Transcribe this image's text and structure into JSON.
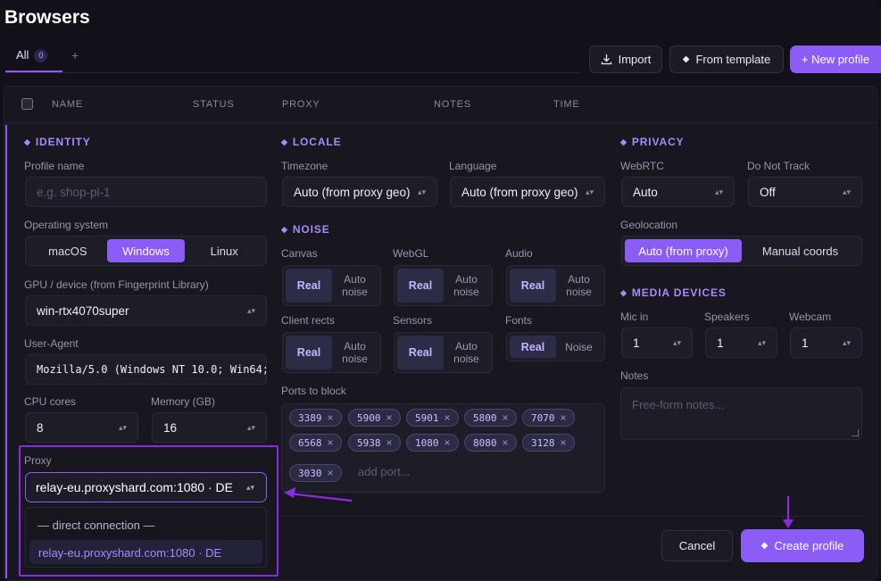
{
  "page": {
    "title": "Browsers"
  },
  "tabs": {
    "all_label": "All",
    "all_count": "0",
    "add_label": "+"
  },
  "toolbar": {
    "import_label": "Import",
    "template_label": "From template",
    "new_label": "+ New profile"
  },
  "table": {
    "columns": [
      "NAME",
      "STATUS",
      "PROXY",
      "NOTES",
      "TIME"
    ]
  },
  "identity": {
    "title": "IDENTITY",
    "profile_name_label": "Profile name",
    "profile_name_placeholder": "e.g. shop-pl-1",
    "os_label": "Operating system",
    "os_options": [
      "macOS",
      "Windows",
      "Linux"
    ],
    "os_selected": "Windows",
    "gpu_label": "GPU / device (from Fingerprint Library)",
    "gpu_value": "win-rtx4070super",
    "ua_label": "User-Agent",
    "ua_value": "Mozilla/5.0 (Windows NT 10.0; Win64;",
    "cpu_label": "CPU cores",
    "cpu_value": "8",
    "memory_label": "Memory (GB)",
    "memory_value": "16",
    "proxy_label": "Proxy",
    "proxy_value": "relay-eu.proxyshard.com:1080 · DE",
    "proxy_options": [
      "— direct connection —",
      "relay-eu.proxyshard.com:1080 · DE"
    ]
  },
  "locale": {
    "title": "LOCALE",
    "timezone_label": "Timezone",
    "timezone_value": "Auto (from proxy geo)",
    "language_label": "Language",
    "language_value": "Auto (from proxy geo)"
  },
  "noise": {
    "title": "NOISE",
    "items": [
      {
        "label": "Canvas",
        "on": "Real",
        "off": "Auto noise"
      },
      {
        "label": "WebGL",
        "on": "Real",
        "off": "Auto noise"
      },
      {
        "label": "Audio",
        "on": "Real",
        "off": "Auto noise"
      },
      {
        "label": "Client rects",
        "on": "Real",
        "off": "Auto noise"
      },
      {
        "label": "Sensors",
        "on": "Real",
        "off": "Auto noise"
      },
      {
        "label": "Fonts",
        "on": "Real",
        "off": "Noise"
      }
    ],
    "ports_label": "Ports to block",
    "ports": [
      "3389",
      "5900",
      "5901",
      "5800",
      "7070",
      "6568",
      "5938",
      "1080",
      "8080",
      "3128",
      "3030"
    ],
    "add_port_placeholder": "add port..."
  },
  "privacy": {
    "title": "PRIVACY",
    "webrtc_label": "WebRTC",
    "webrtc_value": "Auto",
    "dnt_label": "Do Not Track",
    "dnt_value": "Off",
    "geo_label": "Geolocation",
    "geo_options": [
      "Auto (from proxy)",
      "Manual coords"
    ],
    "geo_selected": "Auto (from proxy)"
  },
  "media": {
    "title": "MEDIA DEVICES",
    "mic_label": "Mic in",
    "mic_value": "1",
    "speakers_label": "Speakers",
    "speakers_value": "1",
    "webcam_label": "Webcam",
    "webcam_value": "1",
    "notes_label": "Notes",
    "notes_placeholder": "Free-form notes..."
  },
  "footer": {
    "cancel_label": "Cancel",
    "create_label": "Create profile"
  },
  "colors": {
    "accent": "#8b5cf6",
    "annotation": "#8a2be2",
    "background": "#12111a"
  }
}
